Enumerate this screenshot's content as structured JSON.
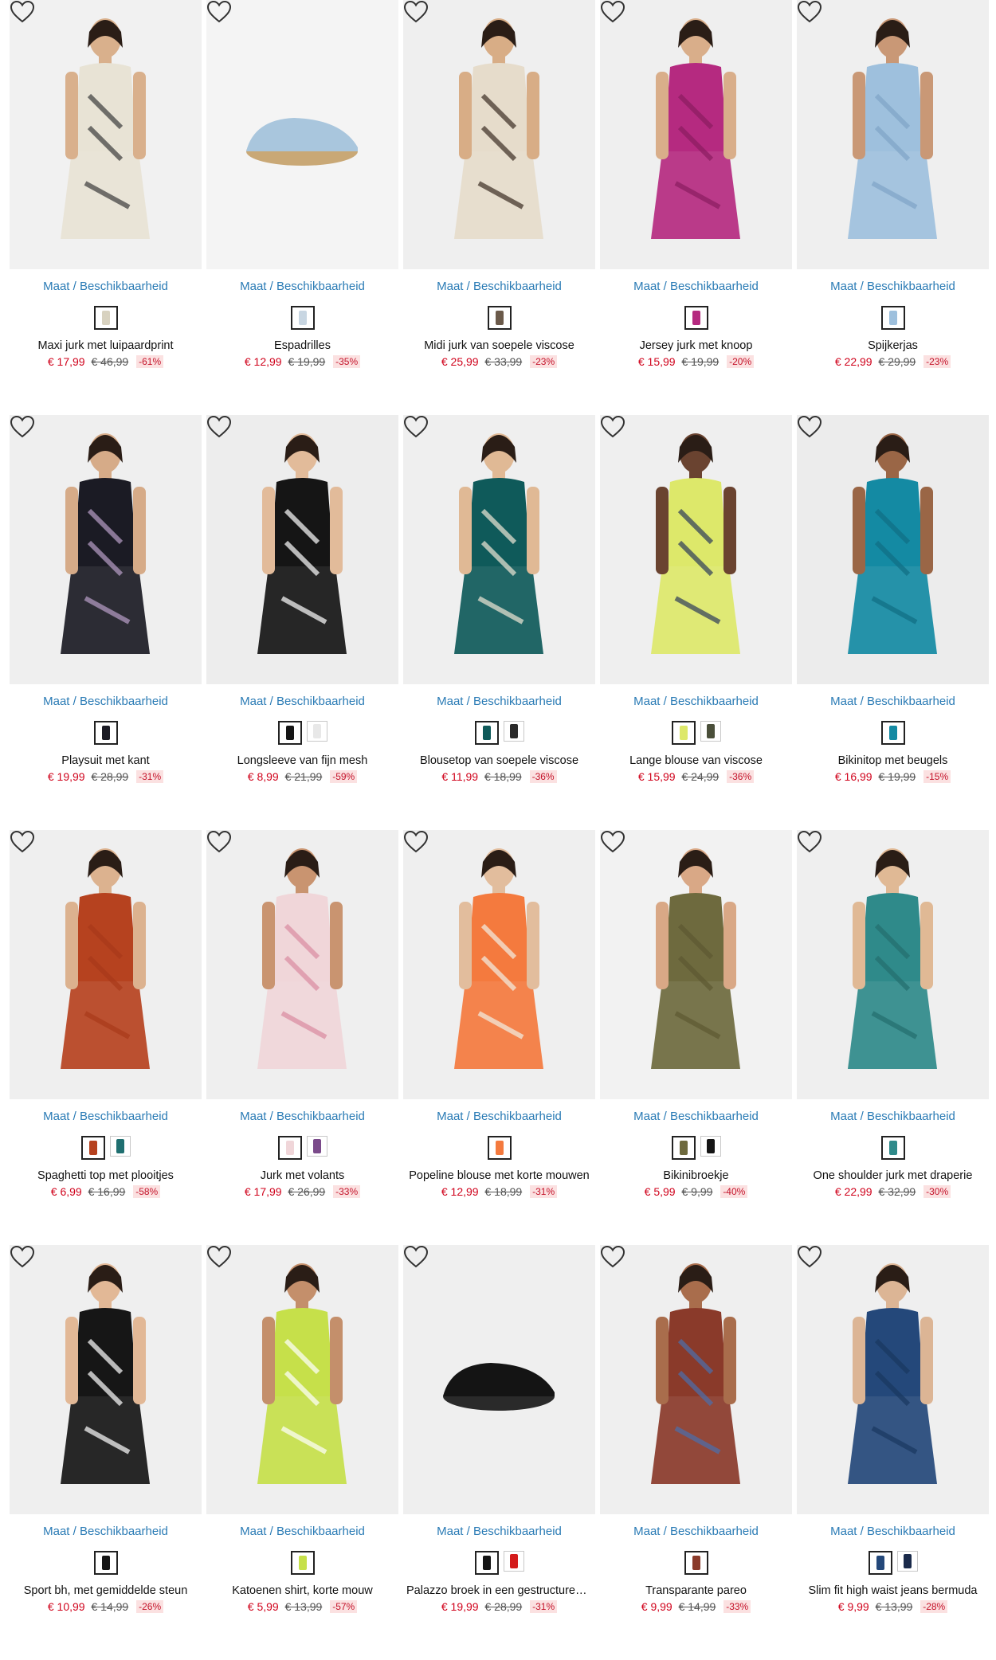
{
  "size_link_label": "Maat / Beschikbaarheid",
  "colors": {
    "accent": "#2a7bb5",
    "price": "#d0021b",
    "badge_bg": "#fbe1e1"
  },
  "products": [
    {
      "name": "Maxi jurk met luipaardprint",
      "price": "€ 17,99",
      "old_price": "€ 46,99",
      "discount": "-61%",
      "img_bg": "#f1f1f1",
      "garment": "#e8e3d5",
      "accent": "#3a3a3a",
      "skin": "#d9b08c",
      "swatches": [
        "#d8d2c0"
      ]
    },
    {
      "name": "Espadrilles",
      "price": "€ 12,99",
      "old_price": "€ 19,99",
      "discount": "-35%",
      "img_bg": "#f4f4f4",
      "garment": "#a9c6dd",
      "accent": "#c9a876",
      "skin": "",
      "swatches": [
        "#c8d6e2"
      ]
    },
    {
      "name": "Midi jurk van soepele viscose",
      "price": "€ 25,99",
      "old_price": "€ 33,99",
      "discount": "-23%",
      "img_bg": "#efefef",
      "garment": "#e6dccb",
      "accent": "#3a2c22",
      "skin": "#d8ad86",
      "swatches": [
        "#6b5a4a"
      ]
    },
    {
      "name": "Jersey jurk met knoop",
      "price": "€ 15,99",
      "old_price": "€ 19,99",
      "discount": "-20%",
      "img_bg": "#efefef",
      "garment": "#b52a80",
      "accent": "#8a1c60",
      "skin": "#d9ae8a",
      "swatches": [
        "#b52a80"
      ]
    },
    {
      "name": "Spijkerjas",
      "price": "€ 22,99",
      "old_price": "€ 29,99",
      "discount": "-23%",
      "img_bg": "#efefef",
      "garment": "#9ec0dd",
      "accent": "#7fa4c6",
      "skin": "#c99876",
      "swatches": [
        "#9ec0dd"
      ]
    },
    {
      "name": "Playsuit met kant",
      "price": "€ 19,99",
      "old_price": "€ 28,99",
      "discount": "-31%",
      "img_bg": "#efefef",
      "garment": "#1b1b24",
      "accent": "#b89ec8",
      "skin": "#d6ab88",
      "swatches": [
        "#1b1b24"
      ]
    },
    {
      "name": "Longsleeve van fijn mesh",
      "price": "€ 8,99",
      "old_price": "€ 21,99",
      "discount": "-59%",
      "img_bg": "#ededed",
      "garment": "#151515",
      "accent": "#ffffff",
      "skin": "#e2bb9a",
      "swatches": [
        "#151515",
        "#e8e8e8"
      ]
    },
    {
      "name": "Blousetop van soepele viscose",
      "price": "€ 11,99",
      "old_price": "€ 18,99",
      "discount": "-36%",
      "img_bg": "#efefef",
      "garment": "#0f5a5a",
      "accent": "#efe7d6",
      "skin": "#e0b995",
      "swatches": [
        "#0f5a5a",
        "#2a2a2a"
      ]
    },
    {
      "name": "Lange blouse van viscose",
      "price": "€ 15,99",
      "old_price": "€ 24,99",
      "discount": "-36%",
      "img_bg": "#efefef",
      "garment": "#dde86a",
      "accent": "#2c3b5a",
      "skin": "#6a4330",
      "swatches": [
        "#dde86a",
        "#4a4f3a"
      ]
    },
    {
      "name": "Bikinitop met beugels",
      "price": "€ 16,99",
      "old_price": "€ 19,99",
      "discount": "-15%",
      "img_bg": "#ececec",
      "garment": "#148aa3",
      "accent": "#0f6e83",
      "skin": "#9a6646",
      "swatches": [
        "#148aa3"
      ]
    },
    {
      "name": "Spaghetti top met plooitjes",
      "price": "€ 6,99",
      "old_price": "€ 16,99",
      "discount": "-58%",
      "img_bg": "#efefef",
      "garment": "#b6421f",
      "accent": "#a8391a",
      "skin": "#dcb28f",
      "swatches": [
        "#b6421f",
        "#1f6f70"
      ]
    },
    {
      "name": "Jurk met volants",
      "price": "€ 17,99",
      "old_price": "€ 26,99",
      "discount": "-33%",
      "img_bg": "#efefef",
      "garment": "#f0d6d9",
      "accent": "#d98aa0",
      "skin": "#c99470",
      "swatches": [
        "#f0d6d9",
        "#7a4a8a"
      ]
    },
    {
      "name": "Popeline blouse met korte mouwen",
      "price": "€ 12,99",
      "old_price": "€ 18,99",
      "discount": "-31%",
      "img_bg": "#efefef",
      "garment": "#f47a3e",
      "accent": "#f1efe6",
      "skin": "#e2bd9d",
      "swatches": [
        "#f47a3e"
      ]
    },
    {
      "name": "Bikinibroekje",
      "price": "€ 5,99",
      "old_price": "€ 9,99",
      "discount": "-40%",
      "img_bg": "#f2f2f2",
      "garment": "#6e6a3e",
      "accent": "#5c5932",
      "skin": "#d9a886",
      "swatches": [
        "#6e6a3e",
        "#151515"
      ]
    },
    {
      "name": "One shoulder jurk met draperie",
      "price": "€ 22,99",
      "old_price": "€ 32,99",
      "discount": "-30%",
      "img_bg": "#efefef",
      "garment": "#2f8a8a",
      "accent": "#246e6e",
      "skin": "#e0b995",
      "swatches": [
        "#2f8a8a"
      ]
    },
    {
      "name": "Sport bh, met gemiddelde steun",
      "price": "€ 10,99",
      "old_price": "€ 14,99",
      "discount": "-26%",
      "img_bg": "#efefef",
      "garment": "#161616",
      "accent": "#ffffff",
      "skin": "#e2b896",
      "swatches": [
        "#161616"
      ]
    },
    {
      "name": "Katoenen shirt, korte mouw",
      "price": "€ 5,99",
      "old_price": "€ 13,99",
      "discount": "-57%",
      "img_bg": "#efefef",
      "garment": "#c6e04a",
      "accent": "#ffffff",
      "skin": "#c48f6b",
      "swatches": [
        "#c6e04a"
      ]
    },
    {
      "name": "Palazzo broek in een gestructureer...",
      "price": "€ 19,99",
      "old_price": "€ 28,99",
      "discount": "-31%",
      "img_bg": "#efefef",
      "garment": "#141414",
      "accent": "#2a2a2a",
      "skin": "",
      "swatches": [
        "#141414",
        "#d41b1b"
      ]
    },
    {
      "name": "Transparante pareo",
      "price": "€ 9,99",
      "old_price": "€ 14,99",
      "discount": "-33%",
      "img_bg": "#efefef",
      "garment": "#8a3a2a",
      "accent": "#4a6fae",
      "skin": "#a96d4c",
      "swatches": [
        "#8a3a2a"
      ]
    },
    {
      "name": "Slim fit high waist jeans bermuda",
      "price": "€ 9,99",
      "old_price": "€ 13,99",
      "discount": "-28%",
      "img_bg": "#efefef",
      "garment": "#24487a",
      "accent": "#1a3760",
      "skin": "#dcb595",
      "swatches": [
        "#24487a",
        "#1a2a4a"
      ]
    }
  ]
}
